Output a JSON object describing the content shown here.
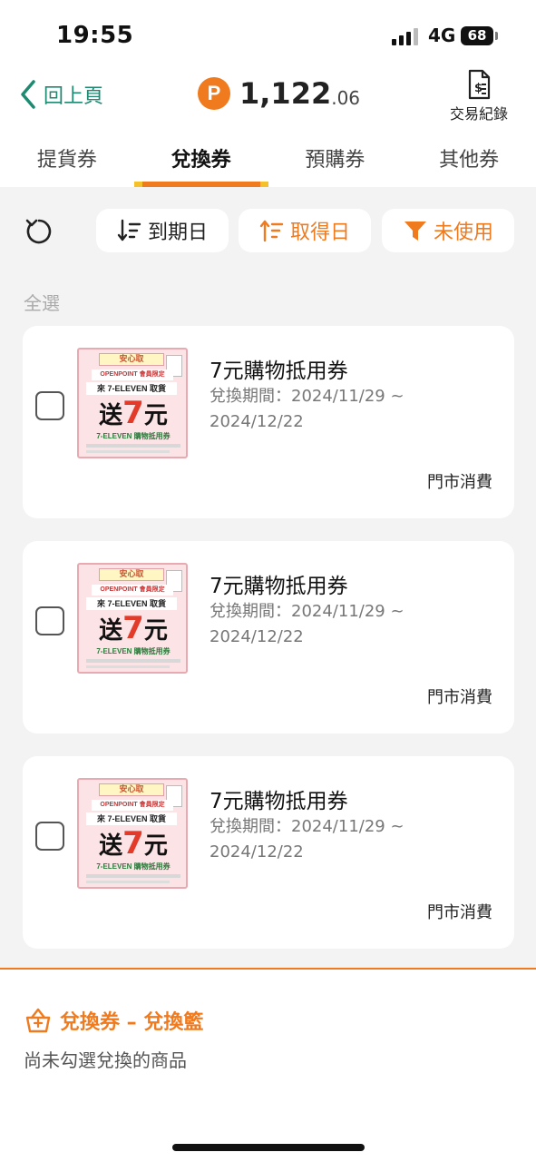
{
  "status_bar": {
    "time": "19:55",
    "network": "4G",
    "battery": "68"
  },
  "header": {
    "back_label": "回上頁",
    "points_icon_letter": "P",
    "points_integer": "1,122",
    "points_decimal": ".06",
    "records_label": "交易紀錄"
  },
  "tabs": [
    {
      "label": "提貨券",
      "active": false
    },
    {
      "label": "兌換券",
      "active": true
    },
    {
      "label": "預購券",
      "active": false
    },
    {
      "label": "其他券",
      "active": false
    }
  ],
  "filters": {
    "expire_label": "到期日",
    "obtain_label": "取得日",
    "unused_label": "未使用"
  },
  "select_all_label": "全選",
  "coupons": [
    {
      "title": "7元購物抵用券",
      "period": "兌換期間：2024/11/29 ~ 2024/12/22",
      "tag": "門市消費"
    },
    {
      "title": "7元購物抵用券",
      "period": "兌換期間：2024/11/29 ~ 2024/12/22",
      "tag": "門市消費"
    },
    {
      "title": "7元購物抵用券",
      "period": "兌換期間：2024/11/29 ~ 2024/12/22",
      "tag": "門市消費"
    }
  ],
  "coupon_image": {
    "banner": "安心取",
    "line1": "OPENPOINT 會員限定",
    "line2": "來 7-ELEVEN 取貨",
    "big_prefix": "送",
    "big_value": "7",
    "big_suffix": "元",
    "line3": "7-ELEVEN 購物抵用券"
  },
  "basket": {
    "title": "兌換券 – 兌換籃",
    "empty_text": "尚未勾選兌換的商品"
  },
  "colors": {
    "accent": "#f07a1e",
    "back_green": "#1e8a72"
  }
}
